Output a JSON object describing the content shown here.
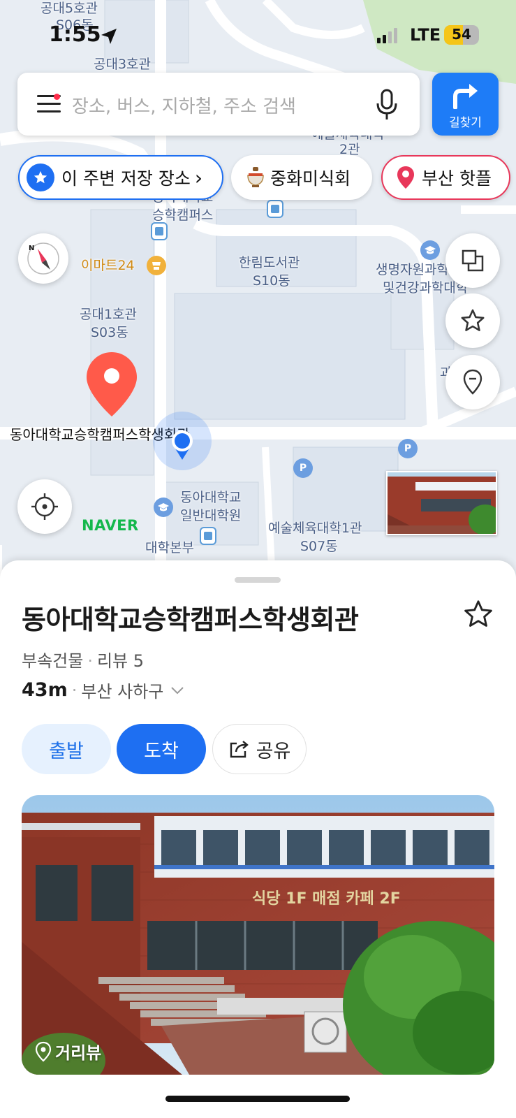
{
  "status": {
    "time": "1:55",
    "network": "LTE",
    "battery": "54",
    "battery_level": 0.54,
    "signal_bars": 2
  },
  "search": {
    "placeholder": "장소, 버스, 지하철, 주소 검색",
    "route_label": "길찾기"
  },
  "chips": {
    "saved": "이 주변 저장 장소",
    "saved_arrow": "›",
    "food": "중화미식회",
    "hot": "부산 핫플"
  },
  "map": {
    "labels": {
      "eng5": "공대5호관",
      "eng5_code": "S06동",
      "eng3": "공대3호관",
      "arts_college_top": "예술체육대학",
      "arts_college_top2": "2관",
      "campus_a": "동아대학교",
      "campus_b": "승학캠퍼스",
      "emart": "이마트24",
      "library": "한림도서관",
      "library_code": "S10동",
      "bio_a": "생명자원과학",
      "bio_b": "및건강과학대학",
      "eng1": "공대1호관",
      "eng1_code": "S03동",
      "selected_place": "동아대학교승학캠퍼스학생회관",
      "grad_a": "동아대학교",
      "grad_b": "일반대학원",
      "arts1": "예술체육대학1관",
      "arts1_code": "S07동",
      "hq": "대학본부",
      "edge_label": "과"
    },
    "parking": "P",
    "attribution": "NAVER",
    "compass_letter": "N"
  },
  "place": {
    "name": "동아대학교승학캠퍼스학생회관",
    "category": "부속건물",
    "review_label": "리뷰 5",
    "distance": "43m",
    "region": "부산 사하구",
    "depart_label": "출발",
    "arrive_label": "도착",
    "share_label": "공유",
    "roadview_label": "거리뷰",
    "sign_text": {
      "line1": "식당 1F 매점 카페 2F"
    }
  },
  "colors": {
    "accent": "#1e6ff2",
    "hot": "#e8375a",
    "marker": "#ff5a4a",
    "naver": "#14b84c"
  },
  "icons": [
    "menu-icon",
    "mic-icon",
    "route-arrow-icon",
    "star-icon",
    "bowl-icon",
    "pin-icon",
    "compass-icon",
    "layers-icon",
    "star-outline-icon",
    "pin-outline-icon",
    "crosshair-icon",
    "share-icon",
    "chevron-down-icon",
    "location-arrow-icon"
  ]
}
